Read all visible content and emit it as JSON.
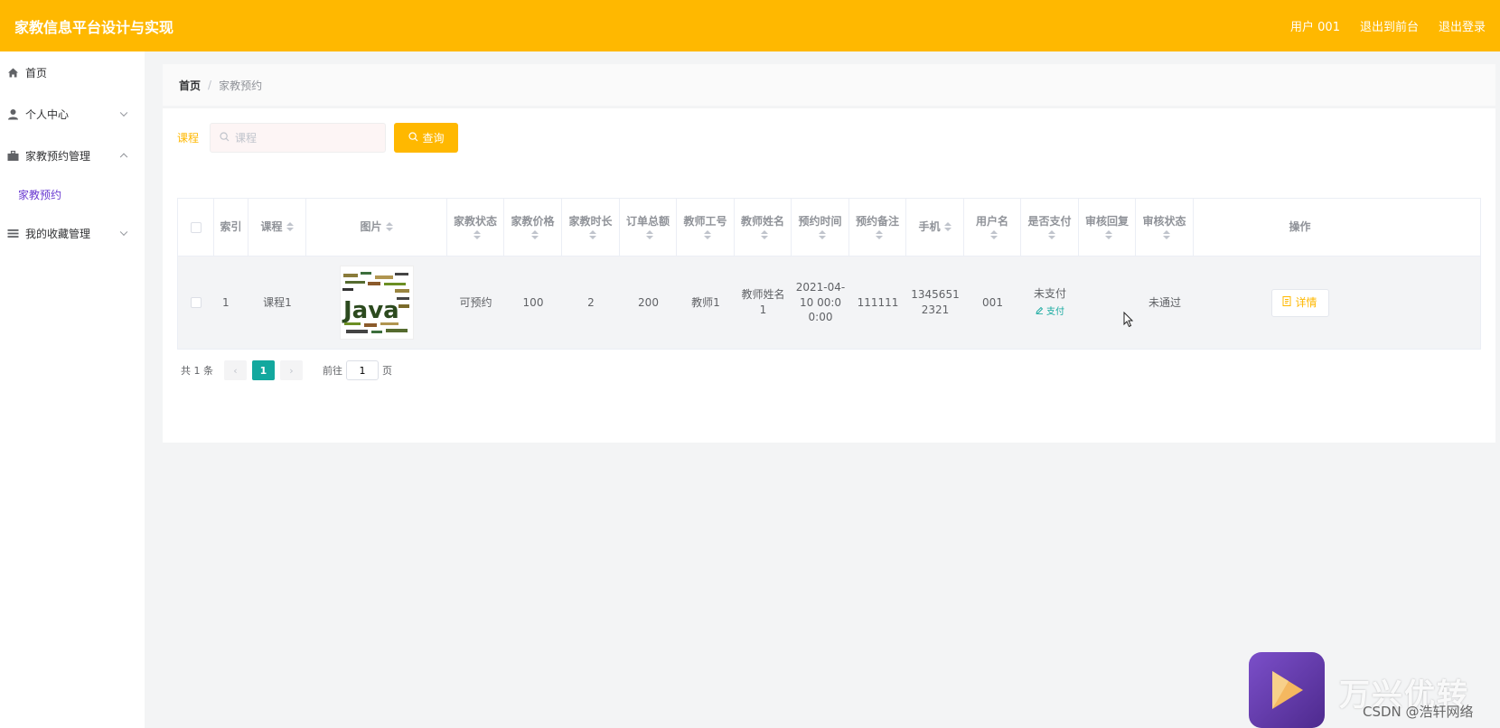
{
  "header": {
    "title": "家教信息平台设计与实现",
    "user_label": "用户 001",
    "back_to_front": "退出到前台",
    "logout": "退出登录"
  },
  "sidebar": {
    "items": [
      {
        "label": "首页",
        "icon": "home-icon"
      },
      {
        "label": "个人中心",
        "icon": "user-icon"
      },
      {
        "label": "家教预约管理",
        "icon": "briefcase-icon"
      },
      {
        "label": "我的收藏管理",
        "icon": "list-icon"
      }
    ],
    "submenu": {
      "label": "家教预约"
    }
  },
  "breadcrumb": {
    "home": "首页",
    "separator": "/",
    "current": "家教预约"
  },
  "search": {
    "label": "课程",
    "placeholder": "课程",
    "button": "查询"
  },
  "table": {
    "headers": {
      "index": "索引",
      "course": "课程",
      "image": "图片",
      "status": "家教状态",
      "price": "家教价格",
      "duration": "家教时长",
      "total": "订单总额",
      "teacher_id": "教师工号",
      "teacher_name": "教师姓名",
      "time": "预约时间",
      "remark": "预约备注",
      "phone": "手机",
      "username": "用户名",
      "paid": "是否支付",
      "reply": "审核回复",
      "audit": "审核状态",
      "action": "操作"
    },
    "rows": [
      {
        "index": "1",
        "course": "课程1",
        "image_alt": "Java",
        "status": "可预约",
        "price": "100",
        "duration": "2",
        "total": "200",
        "teacher_id": "教师1",
        "teacher_name": "教师姓名1",
        "time": "2021-04-10 00:00:00",
        "remark": "111111",
        "phone": "13456512321",
        "username": "001",
        "paid": "未支付",
        "pay_action": "支付",
        "reply": "",
        "audit": "未通过",
        "detail": "详情"
      }
    ]
  },
  "pager": {
    "total": "共 1 条",
    "current": "1",
    "goto_label": "前往",
    "goto_value": "1",
    "page_suffix": "页"
  },
  "watermark": {
    "brand": "万兴优转",
    "credit": "CSDN @浩轩网络"
  },
  "colors": {
    "accent": "#ffb800",
    "page_active": "#13a89e",
    "submenu": "#6a3bd1"
  }
}
